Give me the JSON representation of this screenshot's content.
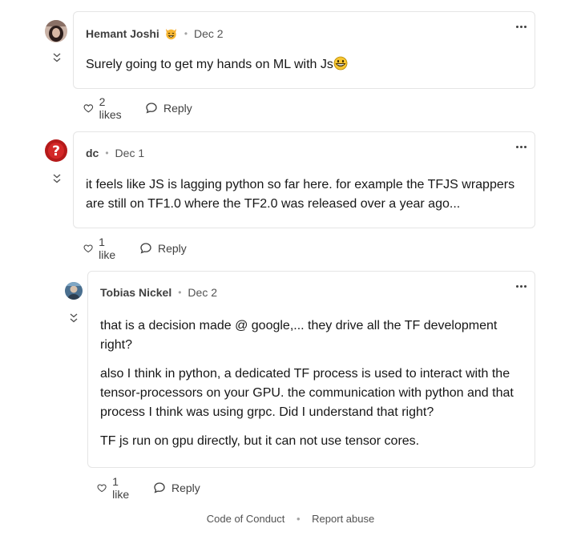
{
  "comments": [
    {
      "author": "Hemant Joshi",
      "badge_icon": "cat-face-icon",
      "date": "Dec 2",
      "text": "Surely going to get my hands on ML with Js",
      "emoji_icon": "grinning-face-icon",
      "likes_label": "2 likes",
      "reply_label": "Reply"
    },
    {
      "author": "dc",
      "date": "Dec 1",
      "text": "it feels like JS is lagging python so far here. for example the TFJS wrappers are still on TF1.0 where the TF2.0 was released over a year ago...",
      "likes_label": "1 like",
      "reply_label": "Reply"
    },
    {
      "author": "Tobias Nickel",
      "date": "Dec 2",
      "paragraphs": [
        "that is a decision made @ google,... they drive all the TF development right?",
        "also I think in python, a dedicated TF process is used to interact with the tensor-processors on your GPU. the communication with python and that process I think was using grpc. Did I understand that right?",
        "TF js run on gpu directly, but it can not use tensor cores."
      ],
      "likes_label": "1 like",
      "reply_label": "Reply"
    }
  ],
  "footer": {
    "code_of_conduct": "Code of Conduct",
    "separator": "•",
    "report_abuse": "Report abuse"
  },
  "colors": {
    "border": "#e5e5e5",
    "text": "#171717",
    "muted": "#525252"
  }
}
